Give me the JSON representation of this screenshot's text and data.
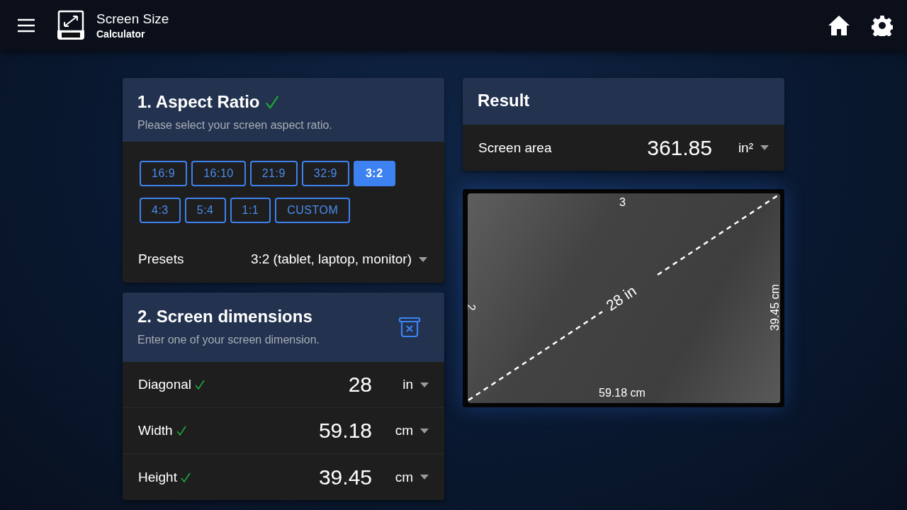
{
  "app_bar": {
    "title": "Screen Size",
    "subtitle": "Calculator"
  },
  "aspect_card": {
    "title": "1. Aspect Ratio",
    "valid": true,
    "description": "Please select your screen aspect ratio.",
    "ratios": [
      {
        "label": "16:9",
        "selected": false
      },
      {
        "label": "16:10",
        "selected": false
      },
      {
        "label": "21:9",
        "selected": false
      },
      {
        "label": "32:9",
        "selected": false
      },
      {
        "label": "3:2",
        "selected": true
      },
      {
        "label": "4:3",
        "selected": false
      },
      {
        "label": "5:4",
        "selected": false
      },
      {
        "label": "1:1",
        "selected": false
      },
      {
        "label": "CUSTOM",
        "selected": false
      }
    ],
    "presets": {
      "label": "Presets",
      "value": "3:2 (tablet, laptop, monitor)"
    }
  },
  "dimensions_card": {
    "title": "2. Screen dimensions",
    "description": "Enter one of your screen dimension.",
    "fields": [
      {
        "label": "Diagonal",
        "valid": true,
        "value": "28",
        "unit": "in"
      },
      {
        "label": "Width",
        "valid": true,
        "value": "59.18",
        "unit": "cm"
      },
      {
        "label": "Height",
        "valid": true,
        "value": "39.45",
        "unit": "cm"
      }
    ]
  },
  "result_card": {
    "title": "Result",
    "label": "Screen area",
    "value": "361.85",
    "unit": "in²"
  },
  "preview": {
    "top_label": "3",
    "left_label": "2",
    "right_label": "39.45 cm",
    "bottom_label": "59.18 cm",
    "diagonal_label": "28 in"
  }
}
